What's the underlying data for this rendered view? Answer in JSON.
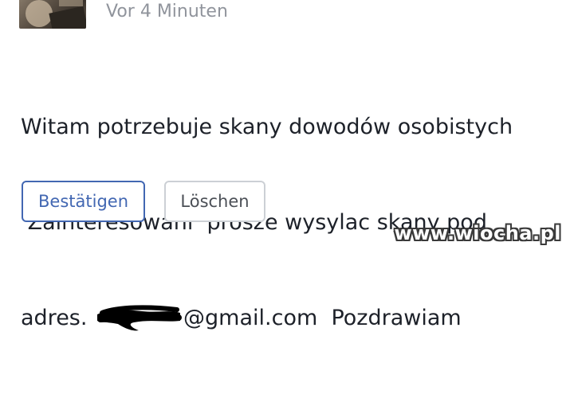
{
  "post": {
    "timestamp": "Vor 4 Minuten",
    "message": {
      "line1": "Witam potrzebuje skany dowodów osobistych",
      "line2": " Zainteresowani  prosze wysylac skany pod",
      "line3_prefix": "adres. ",
      "line3_suffix": "@gmail.com  Pozdrawiam"
    }
  },
  "actions": {
    "confirm_label": "Bestätigen",
    "delete_label": "Löschen"
  },
  "watermark": {
    "text": "www.wiocha.pl"
  },
  "colors": {
    "accent": "#4267b2",
    "timestamp": "#90949c",
    "text": "#1d2129",
    "button_border": "#ccd0d5"
  }
}
